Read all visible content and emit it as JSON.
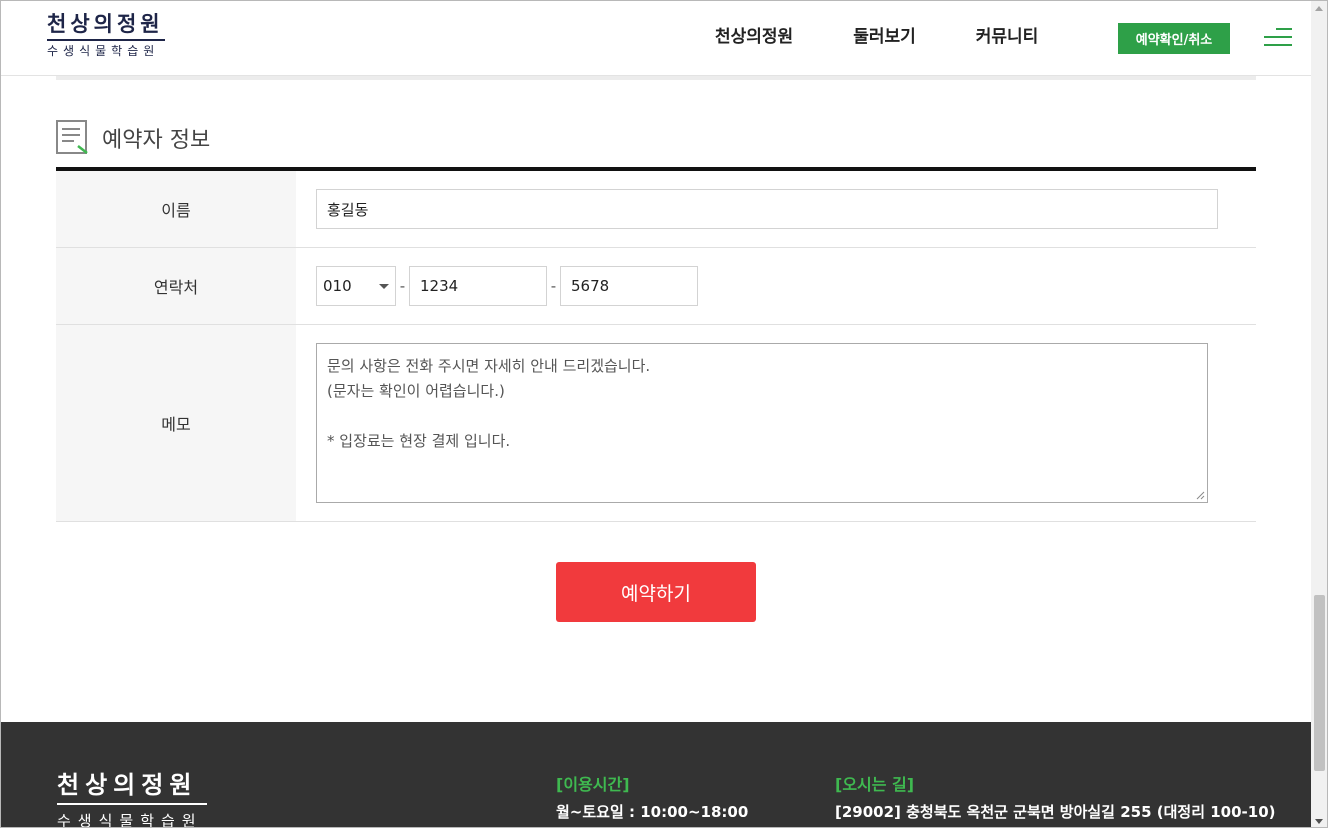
{
  "header": {
    "logo_main": "천상의정원",
    "logo_sub": "수생식물학습원",
    "nav": [
      "천상의정원",
      "둘러보기",
      "커뮤니티"
    ],
    "reserve_button": "예약확인/취소",
    "menu_icon": "hamburger-icon"
  },
  "section": {
    "title": "예약자 정보",
    "icon": "document-icon"
  },
  "form": {
    "name_label": "이름",
    "name_value": "홍길동",
    "phone_label": "연락처",
    "phone_prefix": "010",
    "phone_middle": "1234",
    "phone_last": "5678",
    "phone_separator": "-",
    "memo_label": "메모",
    "memo_value": "문의 사항은 전화 주시면 자세히 안내 드리겠습니다.\n(문자는 확인이 어렵습니다.)\n\n* 입장료는 현장 결제 입니다."
  },
  "submit_label": "예약하기",
  "footer": {
    "logo_main": "천상의정원",
    "logo_sub": "수생식물학습원",
    "hours_title": "[이용시간]",
    "hours_text": "월~토요일 : 10:00~18:00",
    "directions_title": "[오시는 길]",
    "directions_text": "[29002] 충청북도 옥천군 군북면 방아실길 255 (대정리 100-10)"
  },
  "colors": {
    "accent_green": "#2ea048",
    "submit_red": "#f13a3d",
    "logo_navy": "#1e2548",
    "footer_bg": "#333333"
  }
}
